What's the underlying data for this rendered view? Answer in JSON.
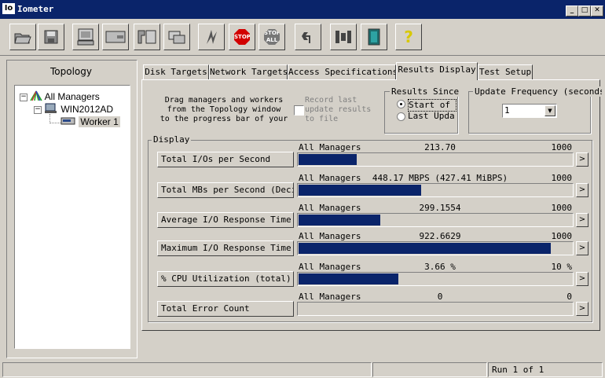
{
  "window": {
    "title": "Iometer",
    "icon_label": "Io",
    "controls": [
      "minimize-icon",
      "maximize-icon",
      "close-icon"
    ]
  },
  "toolbar": {
    "buttons": [
      {
        "name": "open-config-icon"
      },
      {
        "name": "save-config-icon"
      },
      {
        "name": "new-disk-worker-icon"
      },
      {
        "name": "new-network-worker-icon"
      },
      {
        "name": "duplicate-worker-icon"
      },
      {
        "name": "disconnect-icon"
      },
      {
        "name": "start-tests-icon"
      },
      {
        "name": "stop-label",
        "label": "STOP"
      },
      {
        "name": "stop-all-label",
        "label": "STOP ALL"
      },
      {
        "name": "reset-workers-icon"
      },
      {
        "name": "exit-icon"
      },
      {
        "name": "about-icon",
        "label": "?"
      }
    ]
  },
  "topology": {
    "title": "Topology",
    "tree": [
      {
        "label": "All Managers"
      },
      {
        "label": "WIN2012AD"
      },
      {
        "label": "Worker 1"
      }
    ]
  },
  "tabs": [
    "Disk Targets",
    "Network Targets",
    "Access Specifications",
    "Results Display",
    "Test Setup"
  ],
  "active_tab": "Results Display",
  "results": {
    "drag_note": [
      "Drag managers and workers",
      "from the Topology window",
      "to the progress bar of your"
    ],
    "record_last": {
      "label": [
        "Record last",
        "update results",
        "to file"
      ],
      "checked": false
    },
    "results_since": {
      "title": "Results Since",
      "options": [
        "Start of T",
        "Last UpdatІ"
      ],
      "selected": "Start of T"
    },
    "update_frequency": {
      "title": "Update Frequency (seconds)",
      "value": "1"
    },
    "display_title": "Display",
    "metrics": [
      {
        "button": "Total I/Os per Second",
        "manager": "All Managers",
        "value": "213.70",
        "max": "1000",
        "fill": 0.2137
      },
      {
        "button": "Total MBs per Second (Decima",
        "manager": "All Managers",
        "value": "448.17 MBPS (427.41 MiBPS)",
        "max": "1000",
        "fill": 0.448
      },
      {
        "button": "Average I/O Response Time (m",
        "manager": "All Managers",
        "value": "299.1554",
        "max": "1000",
        "fill": 0.2992
      },
      {
        "button": "Maximum I/O Response Time (m",
        "manager": "All Managers",
        "value": "922.6629",
        "max": "1000",
        "fill": 0.9227
      },
      {
        "button": "% CPU Utilization (total)",
        "manager": "All Managers",
        "value": "3.66 %",
        "max": "10 %",
        "fill": 0.366
      },
      {
        "button": "Total Error Count",
        "manager": "All Managers",
        "value": "0",
        "max": "0",
        "fill": 0
      }
    ],
    "more_label": ">"
  },
  "statusbar": {
    "run": "Run 1 of 1"
  }
}
